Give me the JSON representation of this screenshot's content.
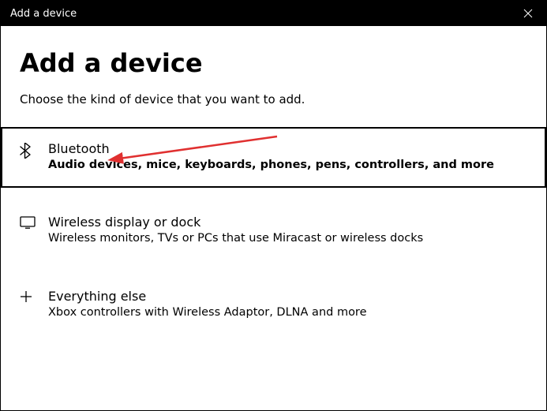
{
  "window": {
    "title": "Add a device"
  },
  "header": {
    "heading": "Add a device",
    "subheading": "Choose the kind of device that you want to add."
  },
  "options": [
    {
      "icon": "bluetooth-icon",
      "title": "Bluetooth",
      "desc": "Audio devices, mice, keyboards, phones, pens, controllers, and more",
      "highlighted": true
    },
    {
      "icon": "display-icon",
      "title": "Wireless display or dock",
      "desc": "Wireless monitors, TVs or PCs that use Miracast or wireless docks",
      "highlighted": false
    },
    {
      "icon": "plus-icon",
      "title": "Everything else",
      "desc": "Xbox controllers with Wireless Adaptor, DLNA and more",
      "highlighted": false
    }
  ]
}
